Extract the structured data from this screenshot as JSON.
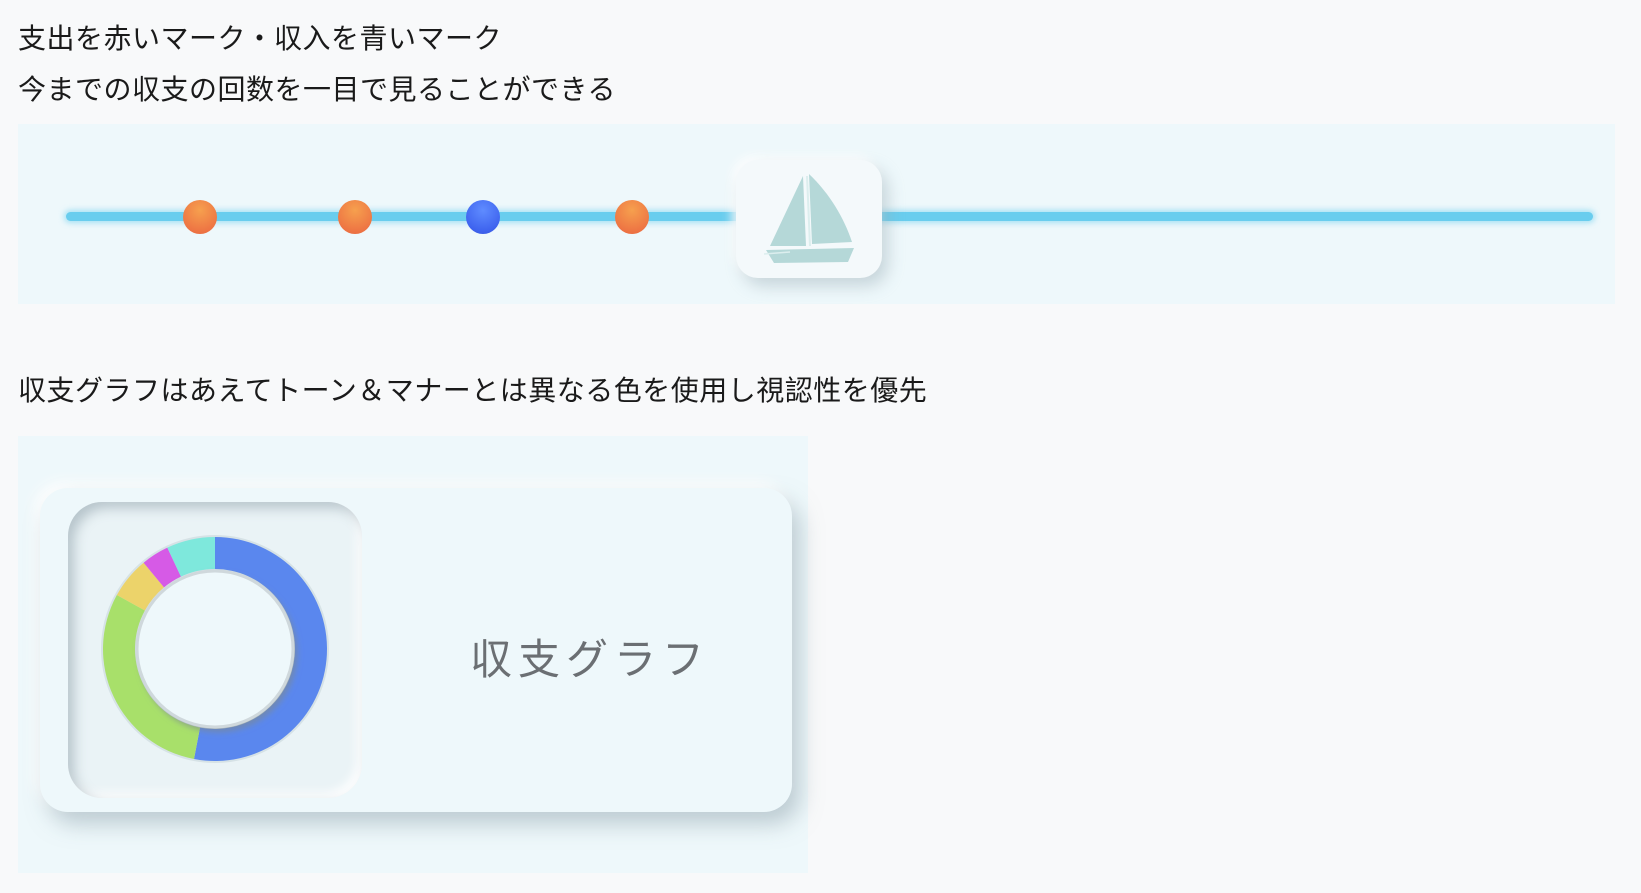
{
  "captions": {
    "line1": "支出を赤いマーク・収入を青いマーク",
    "line2": "今までの収支の回数を一目で見ることができる",
    "line3": "収支グラフはあえてトーン＆マナーとは異なる色を使用し視認性を優先"
  },
  "timeline": {
    "markers": [
      {
        "kind": "expense",
        "color": "#ee7644"
      },
      {
        "kind": "expense",
        "color": "#ee7644"
      },
      {
        "kind": "income",
        "color": "#3f64ef"
      },
      {
        "kind": "expense",
        "color": "#ee7644"
      }
    ],
    "progress_icon": "sailboat-icon",
    "track_color": "#69cdee"
  },
  "graph_card": {
    "label": "収支グラフ",
    "donut_segments": [
      {
        "color": "#5a87ee",
        "fraction": 0.53
      },
      {
        "color": "#a8e06a",
        "fraction": 0.3
      },
      {
        "color": "#ecd36a",
        "fraction": 0.06
      },
      {
        "color": "#d65ae6",
        "fraction": 0.04
      },
      {
        "color": "#7ee8dc",
        "fraction": 0.07
      }
    ]
  }
}
